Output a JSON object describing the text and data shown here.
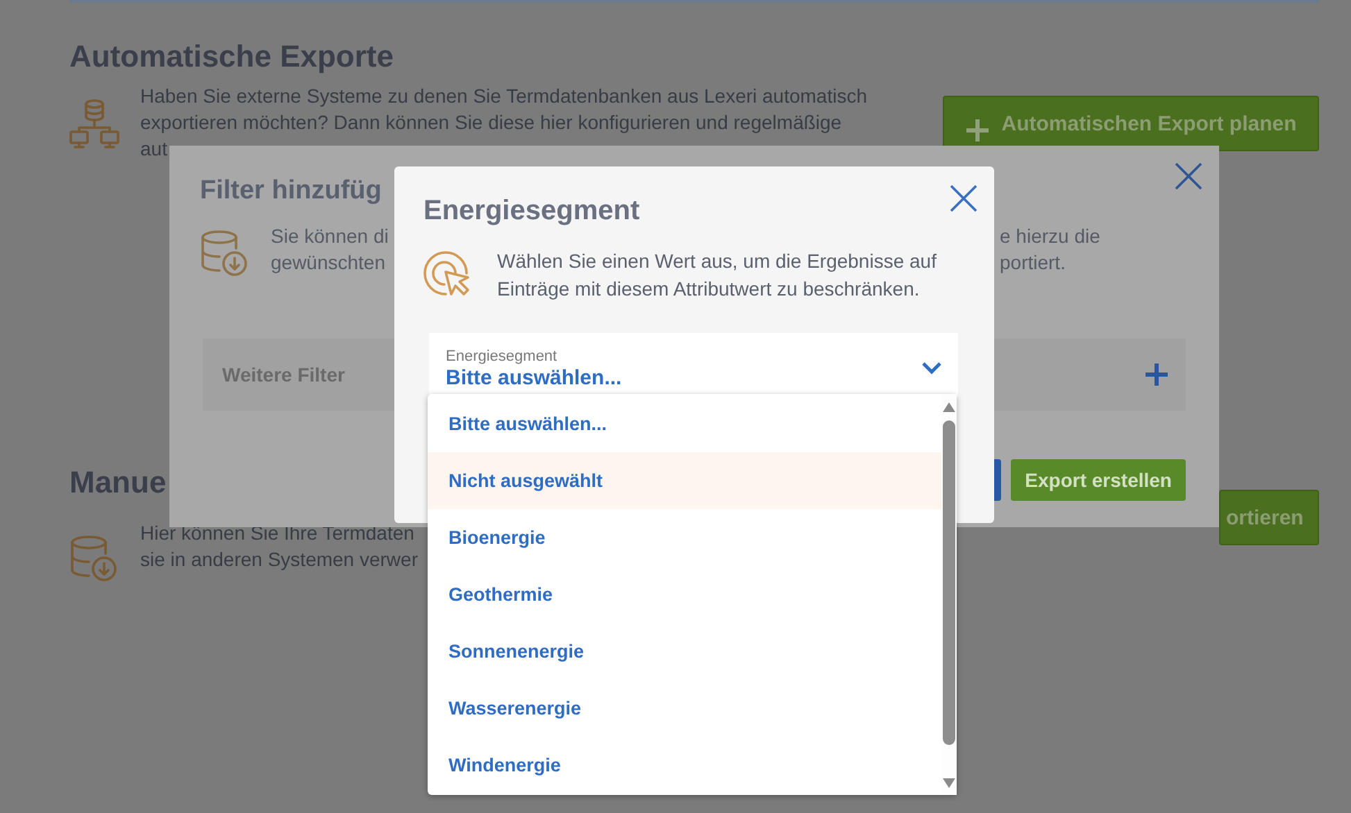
{
  "page": {
    "sections": [
      {
        "title": "Automatische Exporte",
        "text_lines": [
          "Haben Sie externe Systeme zu denen Sie Termdatenbanken aus Lexeri automatisch",
          "exportieren möchten? Dann können Sie diese hier konfigurieren und regelmäßige",
          "aut"
        ],
        "button": {
          "kind": "add",
          "label": "Automatischen Export planen"
        }
      },
      {
        "title": "Manue",
        "text_lines": [
          "Hier können Sie Ihre Termdaten",
          "sie in anderen Systemen verwer"
        ],
        "button": {
          "kind": "plain",
          "label": "ortieren"
        }
      }
    ]
  },
  "filter_dialog": {
    "title": "Filter hinzufüg",
    "text_left": [
      "Sie können di",
      "gewünschten"
    ],
    "text_right": [
      "e hierzu die",
      "portiert."
    ],
    "field": {
      "placeholder": "Weitere Filter"
    },
    "buttons": [
      {
        "kind": "primary"
      },
      {
        "kind": "confirm",
        "label": "Export erstellen"
      }
    ]
  },
  "segment_dialog": {
    "title": "Energiesegment",
    "text_lines": [
      "Wählen Sie einen Wert aus, um die Ergebnisse auf",
      "Einträge mit diesem Attributwert zu beschränken."
    ],
    "select": {
      "label": "Energiesegment",
      "value": "Bitte auswählen...",
      "expanded": true
    },
    "options": [
      {
        "label": "Bitte auswählen...",
        "highlighted": false
      },
      {
        "label": "Nicht ausgewählt",
        "highlighted": true
      },
      {
        "label": "Bioenergie",
        "highlighted": false
      },
      {
        "label": "Geothermie",
        "highlighted": false
      },
      {
        "label": "Sonnenenergie",
        "highlighted": false
      },
      {
        "label": "Wasserenergie",
        "highlighted": false
      },
      {
        "label": "Windenergie",
        "highlighted": false
      }
    ]
  }
}
